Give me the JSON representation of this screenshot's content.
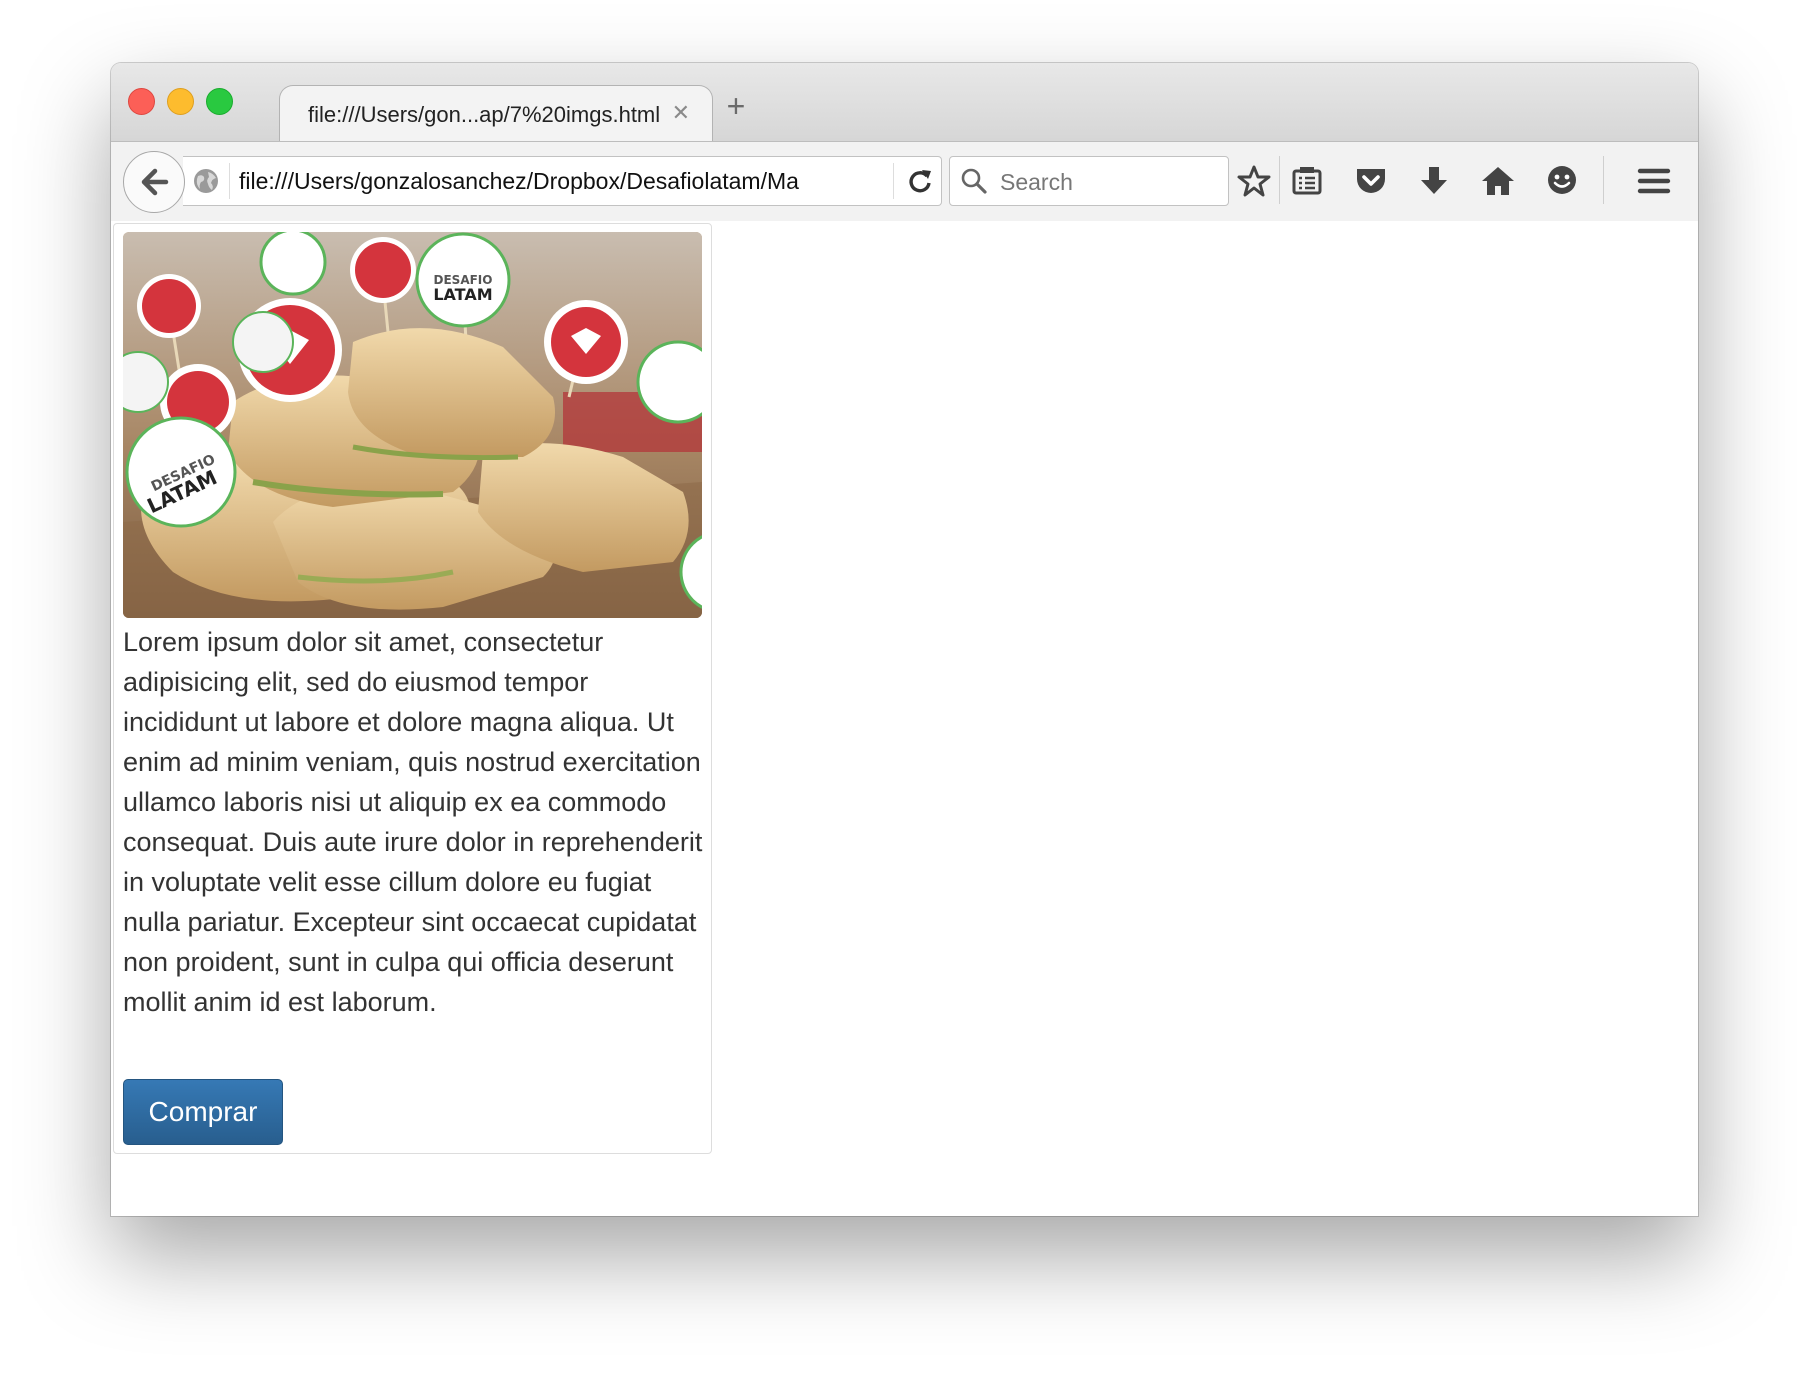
{
  "browser": {
    "tab": {
      "title": "file:///Users/gon...ap/7%20imgs.html",
      "close": "✕"
    },
    "new_tab": "+",
    "url": "file:///Users/gonzalosanchez/Dropbox/Desafiolatam/Ma",
    "search_placeholder": "Search",
    "toolbar_icons": [
      "back-icon",
      "globe-icon",
      "reload-icon",
      "search-icon",
      "bookmark-star-icon",
      "reading-list-icon",
      "pocket-icon",
      "download-icon",
      "home-icon",
      "hello-icon",
      "menu-icon"
    ]
  },
  "card": {
    "image": {
      "description_icons": [
        "ruby-gem-badge",
        "desafio-latam-badge"
      ],
      "badge_text_line1": "DESAFIO",
      "badge_text_line2": "LATAM"
    },
    "text": "Lorem ipsum dolor sit amet, consectetur adipisicing elit, sed do eiusmod tempor incididunt ut labore et dolore magna aliqua. Ut enim ad minim veniam, quis nostrud exercitation ullamco laboris nisi ut aliquip ex ea commodo consequat. Duis aute irure dolor in reprehenderit in voluptate velit esse cillum dolore eu fugiat nulla pariatur. Excepteur sint occaecat cupidatat non proident, sunt in culpa qui officia deserunt mollit anim id est laborum.",
    "button_label": "Comprar"
  },
  "colors": {
    "button": "#286090",
    "close": "#fc5f57",
    "minimize": "#fdbc2e",
    "maximize": "#29c940"
  }
}
